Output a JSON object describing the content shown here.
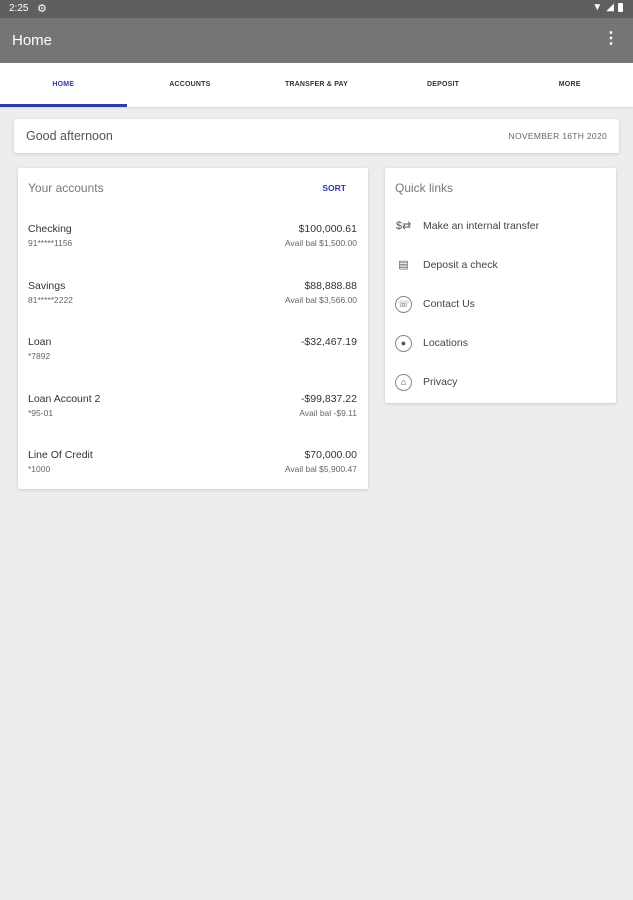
{
  "status_bar": {
    "time": "2:25",
    "settings_icon": "gear-icon",
    "wifi_icon": "wifi-icon",
    "signal_icon": "signal-icon",
    "battery_icon": "battery-icon"
  },
  "app_bar": {
    "title": "Home",
    "menu_icon": "more-vert-icon"
  },
  "tabs": [
    {
      "label": "HOME",
      "active": true
    },
    {
      "label": "ACCOUNTS",
      "active": false
    },
    {
      "label": "TRANSFER & PAY",
      "active": false
    },
    {
      "label": "DEPOSIT",
      "active": false
    },
    {
      "label": "MORE",
      "active": false
    }
  ],
  "greeting": {
    "text": "Good afternoon",
    "date": "NOVEMBER 16TH 2020"
  },
  "accounts": {
    "title": "Your accounts",
    "sort_label": "SORT",
    "items": [
      {
        "name": "Checking",
        "number": "91*****1156",
        "balance": "$100,000.61",
        "avail": "Avail bal $1,500.00"
      },
      {
        "name": "Savings",
        "number": "81*****2222",
        "balance": "$88,888.88",
        "avail": "Avail bal $3,566.00"
      },
      {
        "name": "Loan",
        "number": "*7892",
        "balance": "-$32,467.19",
        "avail": ""
      },
      {
        "name": "Loan Account 2",
        "number": "*95-01",
        "balance": "-$99,837.22",
        "avail": "Avail bal -$9.11"
      },
      {
        "name": "Line Of Credit",
        "number": "*1000",
        "balance": "$70,000.00",
        "avail": "Avail bal $5,900.47"
      }
    ]
  },
  "quick_links": {
    "title": "Quick links",
    "items": [
      {
        "label": "Make an internal transfer",
        "icon": "transfer-icon"
      },
      {
        "label": "Deposit a check",
        "icon": "check-deposit-icon"
      },
      {
        "label": "Contact Us",
        "icon": "phone-icon"
      },
      {
        "label": "Locations",
        "icon": "location-pin-icon"
      },
      {
        "label": "Privacy",
        "icon": "bank-icon"
      }
    ]
  },
  "colors": {
    "accent": "#2f3c9e",
    "app_bar": "#757575",
    "status_bar": "#5f5f5f",
    "background": "#ededed"
  }
}
